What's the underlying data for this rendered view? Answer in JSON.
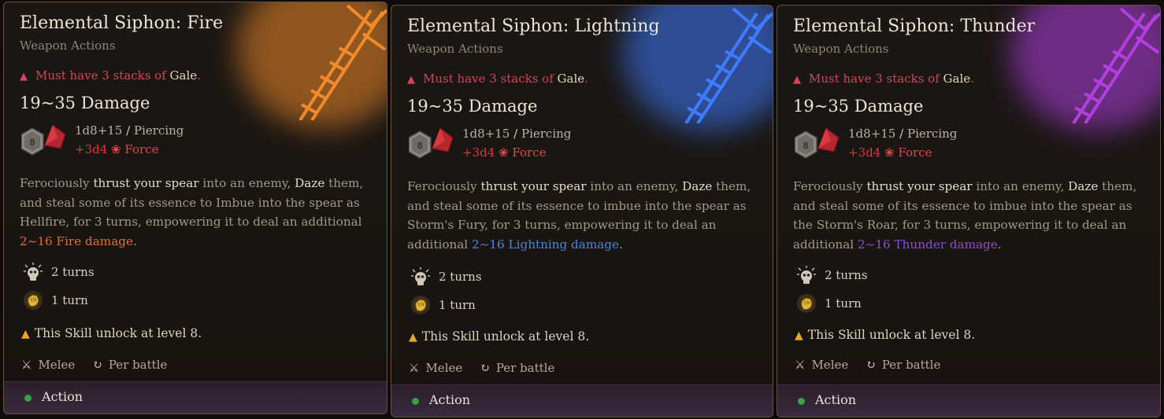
{
  "cards": [
    {
      "title": "Elemental Siphon: Fire",
      "subtitle": "Weapon Actions",
      "requirement": {
        "prefix": "Must have 3 stacks of ",
        "keyword": "Gale",
        "suffix": "."
      },
      "damage": "19~35 Damage",
      "dice_face": "8",
      "dice_line1": {
        "text": "1d8+15",
        "type": "Piercing"
      },
      "dice_line2": {
        "text": "+3d4",
        "type": "Force"
      },
      "description": {
        "p1": "Ferociously ",
        "h1": "thrust your spear",
        "p2": " into an enemy, ",
        "h2": "Daze",
        "p3": " them, and steal some of its essence to Imbue into the spear as Hellfire, for 3 turns, empowering it to deal an additional ",
        "elemental": "2~16 Fire damage",
        "p4": "."
      },
      "element_color": "#e0702a",
      "art_color": "#f08a2a",
      "stat1": "2 turns",
      "stat2": "1 turn",
      "unlock": "This Skill unlock at level 8.",
      "range": "Melee",
      "recharge": "Per battle",
      "action": "Action"
    },
    {
      "title": "Elemental Siphon: Lightning",
      "subtitle": "Weapon Actions",
      "requirement": {
        "prefix": "Must have 3 stacks of ",
        "keyword": "Gale",
        "suffix": "."
      },
      "damage": "19~35 Damage",
      "dice_face": "8",
      "dice_line1": {
        "text": "1d8+15",
        "type": "Piercing"
      },
      "dice_line2": {
        "text": "+3d4",
        "type": "Force"
      },
      "description": {
        "p1": "Ferociously ",
        "h1": "thrust your spear",
        "p2": " into an enemy, ",
        "h2": "Daze",
        "p3": " them, and steal some of its essence to imbue into the spear as Storm's Fury, for 3 turns, empowering it to deal an additional ",
        "elemental": "2~16 Lightning damage",
        "p4": "."
      },
      "element_color": "#4a86d8",
      "art_color": "#3f7bff",
      "stat1": "2 turns",
      "stat2": "1 turn",
      "unlock": "This Skill unlock at level 8.",
      "range": "Melee",
      "recharge": "Per battle",
      "action": "Action"
    },
    {
      "title": "Elemental Siphon: Thunder",
      "subtitle": "Weapon Actions",
      "requirement": {
        "prefix": "Must have 3 stacks of ",
        "keyword": "Gale",
        "suffix": "."
      },
      "damage": "19~35 Damage",
      "dice_face": "8",
      "dice_line1": {
        "text": "1d8+15",
        "type": "Piercing"
      },
      "dice_line2": {
        "text": "+3d4",
        "type": "Force"
      },
      "description": {
        "p1": "Ferociously ",
        "h1": "thrust your spear",
        "p2": " into an enemy, ",
        "h2": "Daze",
        "p3": " them, and steal some of its essence to imbue into the spear as the Storm's Roar, for 3 turns, empowering it to deal an additional ",
        "elemental": "2~16 Thunder damage",
        "p4": "."
      },
      "element_color": "#8d4fc9",
      "art_color": "#b23fe0",
      "stat1": "2 turns",
      "stat2": "1 turn",
      "unlock": "This Skill unlock at level 8.",
      "range": "Melee",
      "recharge": "Per battle",
      "action": "Action"
    }
  ]
}
